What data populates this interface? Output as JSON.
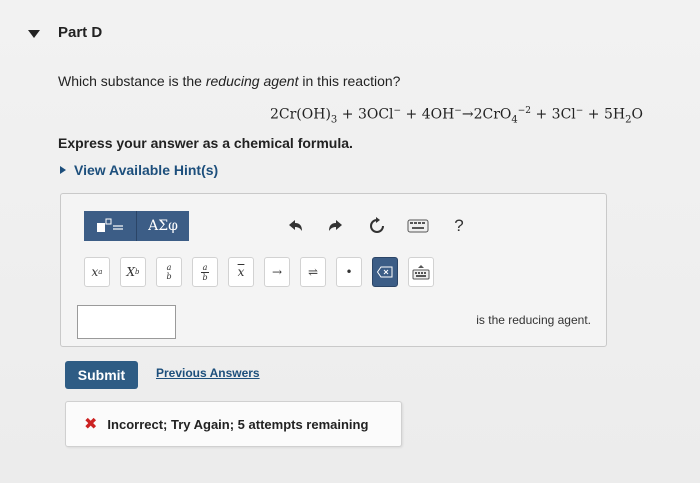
{
  "part": {
    "title": "Part D"
  },
  "question": {
    "prefix": "Which substance is the ",
    "emphasis": "reducing agent",
    "suffix": " in this reaction?"
  },
  "equation": {
    "reactant1_coef": "2Cr(OH)",
    "reactant1_sub": "3",
    "plus1": " + ",
    "reactant2": "3OCl",
    "reactant2_sup": "−",
    "plus2": " + ",
    "reactant3": "4OH",
    "reactant3_sup": "−",
    "arrow": "→",
    "product1": "2CrO",
    "product1_sub": "4",
    "product1_sup": "−2",
    "plus3": " + ",
    "product2": "3Cl",
    "product2_sup": "−",
    "plus4": " + ",
    "product3": "5H",
    "product3_sub": "2",
    "product3_tail": "O"
  },
  "instructions": "Express your answer as a chemical formula.",
  "hints_label": "View Available Hint(s)",
  "toolbar": {
    "greek_label": "ΑΣφ",
    "help_label": "?",
    "superscript_label": "x",
    "superscript_mark": "a",
    "subscript_label": "X",
    "subscript_mark": "b",
    "frac_top": "a",
    "frac_bottom": "b",
    "xbar_label": "x",
    "arrow_label": "→",
    "equilibrium_label": "⇌",
    "dot_label": "•"
  },
  "answer": {
    "value": "",
    "suffix": "is the reducing agent."
  },
  "submit_label": "Submit",
  "previous_answers_label": "Previous Answers",
  "feedback": {
    "icon": "✖",
    "text": "Incorrect; Try Again; 5 attempts remaining"
  },
  "colors": {
    "primary": "#2e5c84",
    "toolbar_dark": "#3c5d86",
    "link": "#1d4f7c",
    "error": "#cc2222"
  }
}
